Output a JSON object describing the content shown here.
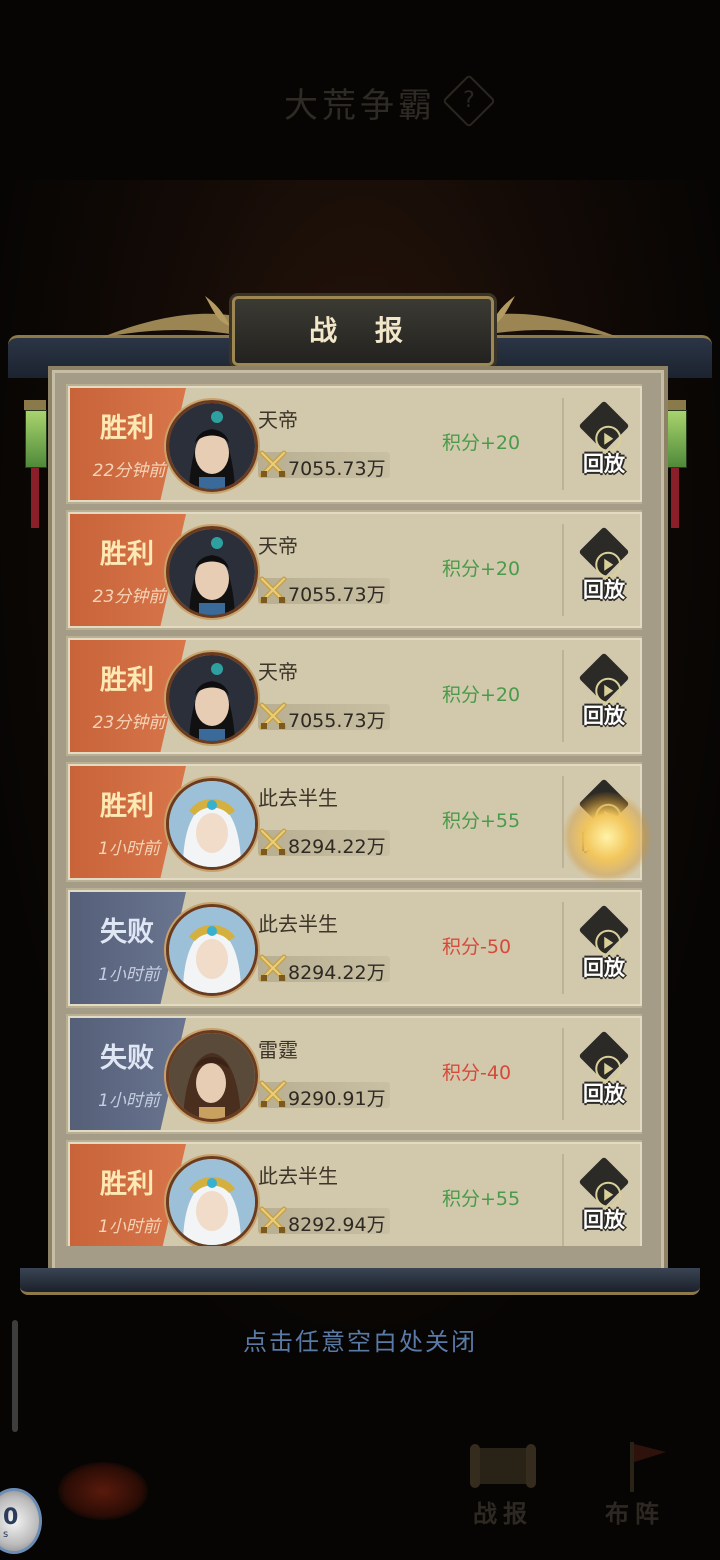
{
  "page_title": "大荒争霸",
  "help_icon": "?",
  "panel_title": "战 报",
  "rows": [
    {
      "result": "胜利",
      "type": "win",
      "time": "22分钟前",
      "name": "天帝",
      "power": "7055.73万",
      "score": "积分+20",
      "score_sign": "pos",
      "replay": "回放",
      "avatar": "black-hair"
    },
    {
      "result": "胜利",
      "type": "win",
      "time": "23分钟前",
      "name": "天帝",
      "power": "7055.73万",
      "score": "积分+20",
      "score_sign": "pos",
      "replay": "回放",
      "avatar": "black-hair"
    },
    {
      "result": "胜利",
      "type": "win",
      "time": "23分钟前",
      "name": "天帝",
      "power": "7055.73万",
      "score": "积分+20",
      "score_sign": "pos",
      "replay": "回放",
      "avatar": "black-hair"
    },
    {
      "result": "胜利",
      "type": "win",
      "time": "1小时前",
      "name": "此去半生",
      "power": "8294.22万",
      "score": "积分+55",
      "score_sign": "pos",
      "replay": "回放",
      "avatar": "white-hair"
    },
    {
      "result": "失败",
      "type": "lose",
      "time": "1小时前",
      "name": "此去半生",
      "power": "8294.22万",
      "score": "积分-50",
      "score_sign": "neg",
      "replay": "回放",
      "avatar": "white-hair"
    },
    {
      "result": "失败",
      "type": "lose",
      "time": "1小时前",
      "name": "雷霆",
      "power": "9290.91万",
      "score": "积分-40",
      "score_sign": "neg",
      "replay": "回放",
      "avatar": "brown-hair"
    },
    {
      "result": "胜利",
      "type": "win",
      "time": "1小时前",
      "name": "此去半生",
      "power": "8292.94万",
      "score": "积分+55",
      "score_sign": "pos",
      "replay": "回放",
      "avatar": "white-hair"
    }
  ],
  "close_hint": "点击任意空白处关闭",
  "bottom_nav": {
    "battle_report": "战报",
    "formation": "布阵"
  },
  "counter": {
    "value": "0",
    "unit": "s"
  },
  "colors": {
    "win": "#c8633a",
    "lose": "#555f78",
    "score_pos": "#4a9a4a",
    "score_neg": "#d64a3a",
    "hint": "#5a7aa6"
  }
}
